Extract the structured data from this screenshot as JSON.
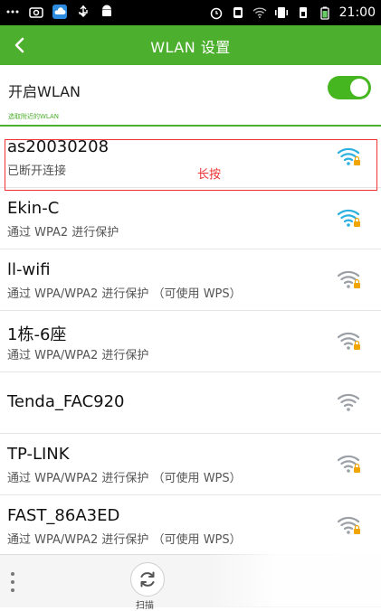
{
  "status_bar": {
    "left_icons": [
      "more-dots-icon",
      "photo-icon",
      "cloud-icon",
      "usb-icon",
      "android-icon"
    ],
    "right_icons": [
      "alarm-icon",
      "app-icon",
      "wifi-icon",
      "vibrate-icon",
      "signal-icon",
      "battery-icon"
    ],
    "time": "21:00"
  },
  "header": {
    "title": "WLAN 设置",
    "back_icon": "chevron-left-icon"
  },
  "toggle": {
    "label": "开启WLAN",
    "on": true
  },
  "section": {
    "label": "选取附近的WLAN"
  },
  "networks": [
    {
      "ssid": "as20030208",
      "status": "已断开连接",
      "locked": true,
      "signal_color": "#2bb0e0"
    },
    {
      "ssid": "Ekin-C",
      "status": "通过 WPA2 进行保护",
      "locked": true,
      "signal_color": "#2bb0e0"
    },
    {
      "ssid": "ll-wifi",
      "status": "通过 WPA/WPA2 进行保护 （可使用 WPS）",
      "locked": true,
      "signal_color": "#9aa0a6"
    },
    {
      "ssid": "1栋-6座",
      "status": "通过 WPA/WPA2 进行保护",
      "locked": true,
      "signal_color": "#9aa0a6"
    },
    {
      "ssid": "Tenda_FAC920",
      "status": "",
      "locked": false,
      "signal_color": "#9aa0a6"
    },
    {
      "ssid": "TP-LINK",
      "status": "通过 WPA/WPA2 进行保护 （可使用 WPS）",
      "locked": true,
      "signal_color": "#9aa0a6"
    },
    {
      "ssid": "FAST_86A3ED",
      "status": "通过 WPA/WPA2 进行保护 （可使用 WPS）",
      "locked": true,
      "signal_color": "#9aa0a6"
    }
  ],
  "annotation": {
    "label": "长按"
  },
  "bottom_bar": {
    "scan_label": "扫描",
    "scan_icon": "refresh-icon",
    "menu_icon": "overflow-menu-icon"
  },
  "colors": {
    "accent": "#4caf2d",
    "annotation": "#e33333"
  }
}
